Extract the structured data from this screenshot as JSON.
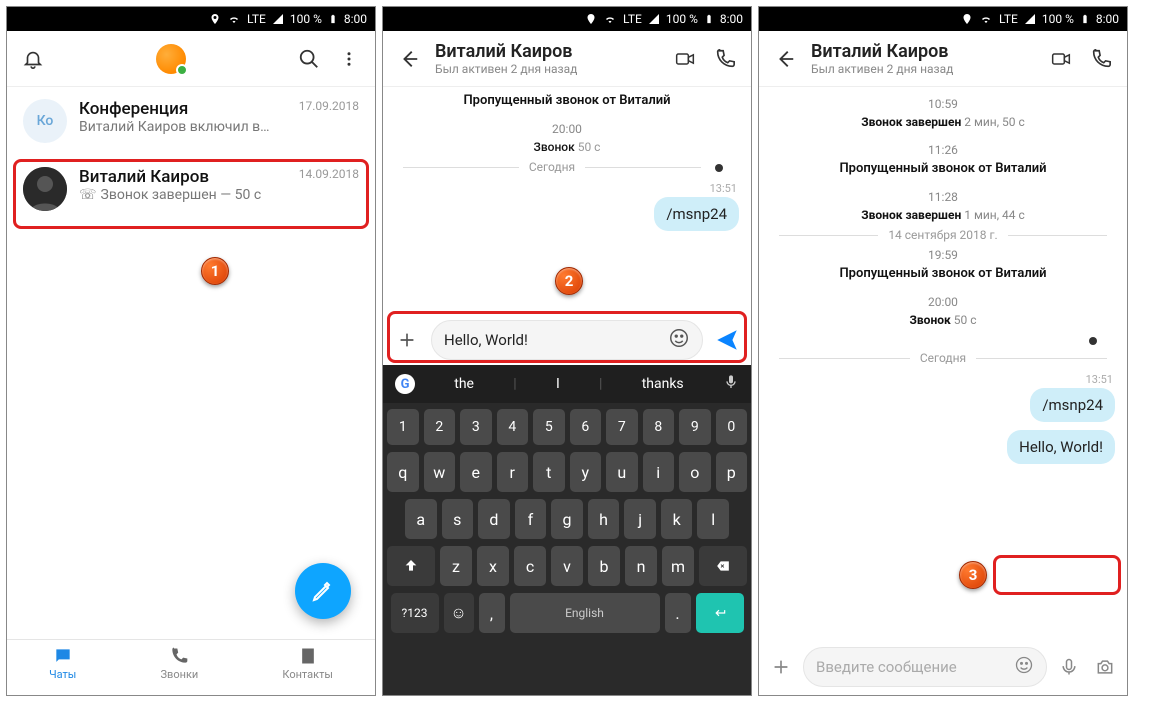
{
  "statusbar": {
    "lte": "LTE",
    "battery": "100 %",
    "time": "8:00"
  },
  "p1": {
    "chats": [
      {
        "avatar": "Ко",
        "name": "Конференция",
        "sub": "Виталий Каиров включил в…",
        "date": "17.09.2018"
      },
      {
        "name": "Виталий Каиров",
        "sub": "Звонок завершен — 50 с",
        "date": "14.09.2018"
      }
    ],
    "nav": {
      "chats": "Чаты",
      "calls": "Звонки",
      "contacts": "Контакты"
    }
  },
  "p2": {
    "title": "Виталий Каиров",
    "subtitle": "Был активен 2 дня назад",
    "sys_missed": "Пропущенный звонок от Виталий",
    "time1": "20:00",
    "call_dur": "Звонок 50 с",
    "today": "Сегодня",
    "msg1_time": "13:51",
    "msg1": "/msnp24",
    "input_text": "Hello, World!",
    "sug": {
      "w1": "the",
      "w2": "I",
      "w3": "thanks"
    },
    "kb": {
      "lang": "English",
      "numkey": "?123"
    }
  },
  "p3": {
    "title": "Виталий Каиров",
    "subtitle": "Был активен 2 дня назад",
    "t1": "10:59",
    "l1a": "Звонок завершен",
    "l1b": "2 мин, 50 с",
    "t2": "11:26",
    "l2": "Пропущенный звонок от Виталий",
    "t3": "11:28",
    "l3a": "Звонок завершен",
    "l3b": "1 мин, 44 с",
    "datesep": "14 сентября 2018 г.",
    "t4": "19:59",
    "l4": "Пропущенный звонок от Виталий",
    "t5": "20:00",
    "l5": "Звонок 50 с",
    "today": "Сегодня",
    "m1t": "13:51",
    "m1": "/msnp24",
    "m2": "Hello, World!",
    "placeholder": "Введите сообщение"
  },
  "badges": {
    "b1": "1",
    "b2": "2",
    "b3": "3"
  }
}
